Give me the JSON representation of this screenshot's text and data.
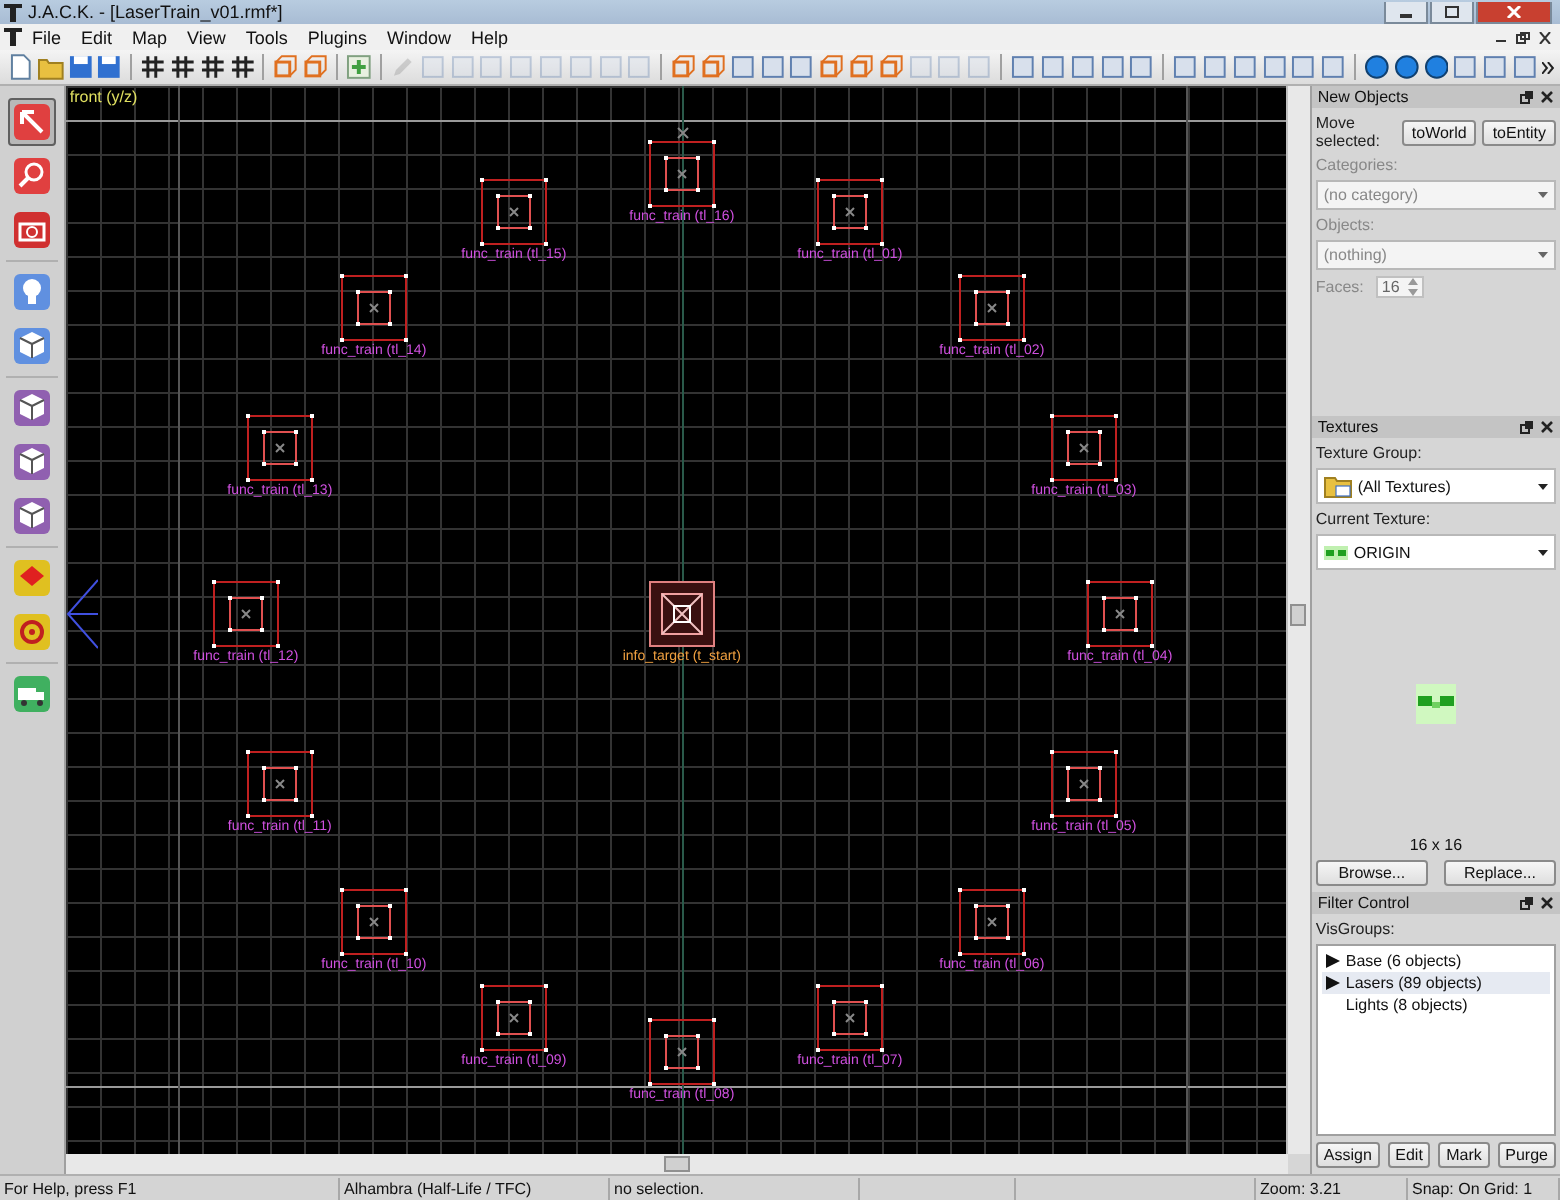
{
  "window": {
    "title": "J.A.C.K. - [LaserTrain_v01.rmf*]"
  },
  "menu": [
    "File",
    "Edit",
    "Map",
    "View",
    "Tools",
    "Plugins",
    "Window",
    "Help"
  ],
  "left_tools": [
    {
      "selected": true
    },
    {
      "selected": false
    },
    {
      "selected": false
    },
    {
      "selected": false
    },
    {
      "selected": false
    },
    {
      "selected": false
    },
    {
      "selected": false
    },
    {
      "selected": false
    },
    {
      "selected": false
    },
    {
      "selected": false
    },
    {
      "selected": false
    }
  ],
  "viewport": {
    "label": "front (y/z)",
    "entities": [
      {
        "kind": "func_train",
        "label": "func_train (tl_16)"
      },
      {
        "kind": "func_train",
        "label": "func_train (tl_15)"
      },
      {
        "kind": "func_train",
        "label": "func_train (tl_01)"
      },
      {
        "kind": "func_train",
        "label": "func_train (tl_14)"
      },
      {
        "kind": "func_train",
        "label": "func_train (tl_02)"
      },
      {
        "kind": "func_train",
        "label": "func_train (tl_13)"
      },
      {
        "kind": "func_train",
        "label": "func_train (tl_03)"
      },
      {
        "kind": "func_train",
        "label": "func_train (tl_12)"
      },
      {
        "kind": "info_target",
        "label": "info_target (t_start)"
      },
      {
        "kind": "func_train",
        "label": "func_train (tl_04)"
      },
      {
        "kind": "func_train",
        "label": "func_train (tl_11)"
      },
      {
        "kind": "func_train",
        "label": "func_train (tl_05)"
      },
      {
        "kind": "func_train",
        "label": "func_train (tl_10)"
      },
      {
        "kind": "func_train",
        "label": "func_train (tl_06)"
      },
      {
        "kind": "func_train",
        "label": "func_train (tl_09)"
      },
      {
        "kind": "func_train",
        "label": "func_train (tl_07)"
      },
      {
        "kind": "func_train",
        "label": "func_train (tl_08)"
      }
    ]
  },
  "new_objects": {
    "title": "New Objects",
    "move_label": "Move selected:",
    "buttons": [
      "toWorld",
      "toEntity"
    ],
    "categories": {
      "label": "Categories:",
      "value": "(no category)",
      "disabled": true
    },
    "objects": {
      "label": "Objects:",
      "value": "(nothing)",
      "disabled": true
    },
    "faces": {
      "label": "Faces:",
      "value": "16",
      "disabled": true
    }
  },
  "textures": {
    "title": "Textures",
    "group_label": "Texture Group:",
    "group_value": "(All Textures)",
    "current_label": "Current Texture:",
    "current_value": "ORIGIN",
    "size": "16 x 16",
    "buttons": [
      "Browse...",
      "Replace..."
    ]
  },
  "filter_control": {
    "title": "Filter Control",
    "list_label": "VisGroups:",
    "groups": [
      {
        "label": "Base (6 objects)",
        "has_children": true,
        "selected": false
      },
      {
        "label": "Lasers (89 objects)",
        "has_children": true,
        "selected": true
      },
      {
        "label": "Lights (8 objects)",
        "has_children": false,
        "selected": false
      }
    ],
    "buttons": [
      "Assign",
      "Edit",
      "Mark",
      "Purge"
    ]
  },
  "status_bar": {
    "help": "For Help, press F1",
    "game": "Alhambra (Half-Life / TFC)",
    "selection": "no selection.",
    "zoom": "Zoom: 3.21",
    "snap": "Snap: On Grid: 1"
  }
}
